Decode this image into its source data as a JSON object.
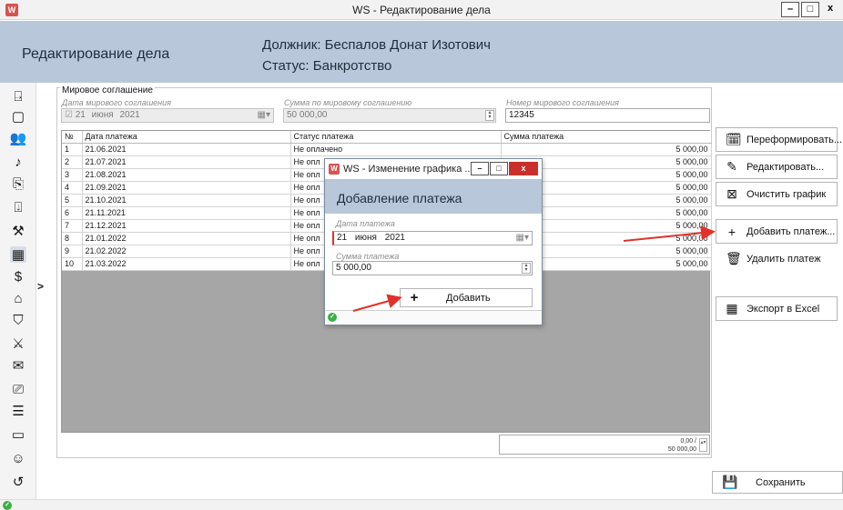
{
  "window": {
    "app_icon": "ws-logo-icon",
    "title": "WS - Редактирование дела",
    "minimize": "–",
    "maximize": "□",
    "close": "x"
  },
  "header": {
    "title": "Редактирование дела",
    "debtor": "Должник: Беспалов Донат Изотович",
    "status": "Статус: Банкротство"
  },
  "sidebar": {
    "icons": [
      "add-document-icon",
      "document-icon",
      "users-icon",
      "bell-icon",
      "file-search-icon",
      "inbox-upload-icon",
      "auction-hammer-icon",
      "calendar-icon",
      "dollar-icon",
      "search-home-icon",
      "police-badge-icon",
      "pick-icon",
      "mail-icon",
      "document-chart-icon",
      "document-lines-icon",
      "chat-icon",
      "speaking-user-icon",
      "history-icon"
    ],
    "active_icon": "calendar-icon",
    "expand_glyph": ">"
  },
  "settlement": {
    "group_title": "Мировое соглашение",
    "date_label": "Дата мирового соглашения",
    "date_day": "21",
    "date_month": "июня",
    "date_year": "2021",
    "date_checked": true,
    "amount_label": "Сумма по мировому соглашению",
    "amount_value": "50 000,00",
    "number_label": "Номер мирового соглашения",
    "number_value": "12345"
  },
  "grid": {
    "columns": [
      "№",
      "Дата платежа",
      "Статус платежа",
      "Сумма платежа"
    ],
    "rows": [
      [
        "1",
        "21.06.2021",
        "Не оплачено",
        "5 000,00"
      ],
      [
        "2",
        "21.07.2021",
        "Не опл",
        "5 000,00"
      ],
      [
        "3",
        "21.08.2021",
        "Не опл",
        "5 000,00"
      ],
      [
        "4",
        "21.09.2021",
        "Не опл",
        "5 000,00"
      ],
      [
        "5",
        "21.10.2021",
        "Не опл",
        "5 000,00"
      ],
      [
        "6",
        "21.11.2021",
        "Не опл",
        "5 000,00"
      ],
      [
        "7",
        "21.12.2021",
        "Не опл",
        "5 000,00"
      ],
      [
        "8",
        "21.01.2022",
        "Не опл",
        "5 000,00"
      ],
      [
        "9",
        "21.02.2022",
        "Не опл",
        "5 000,00"
      ],
      [
        "10",
        "21.03.2022",
        "Не опл",
        "5 000,00"
      ]
    ],
    "total_line1": "0,00 /",
    "total_line2": "50 000,00"
  },
  "actions": {
    "reform": "Переформировать...",
    "edit": "Редактировать...",
    "clear": "Очистить график",
    "add": "Добавить платеж...",
    "delete": "Удалить платеж",
    "export": "Экспорт в Excel",
    "save": "Сохранить"
  },
  "dialog": {
    "title": "WS - Изменение графика ...",
    "header": "Добавление платежа",
    "date_label": "Дата платежа",
    "date_day": "21",
    "date_month": "июня",
    "date_year": "2021",
    "amount_label": "Сумма платежа",
    "amount_value": "5 000,00",
    "add_button": "Добавить",
    "add_glyph": "+"
  },
  "colors": {
    "header_band": "#b8c8da",
    "status_ok": "#3cb043",
    "arrow": "#e0322a",
    "close_button": "#c9302c"
  }
}
